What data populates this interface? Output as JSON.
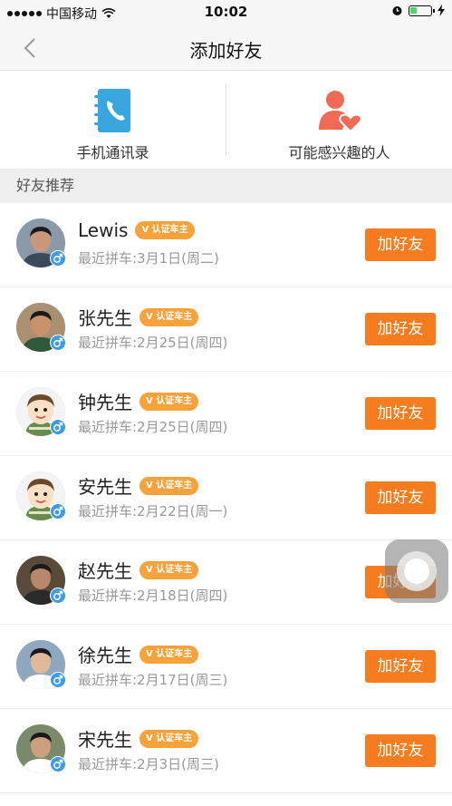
{
  "status_bar": {
    "carrier": "中国移动",
    "time": "10:02",
    "battery_level": 0.35
  },
  "nav": {
    "title": "添加好友",
    "back_icon": "chevron-left-icon"
  },
  "quick_actions": [
    {
      "label": "手机通讯录",
      "icon": "phone-book-icon",
      "color": "#3aa6e0"
    },
    {
      "label": "可能感兴趣的人",
      "icon": "person-heart-icon",
      "color": "#f06a55"
    }
  ],
  "section": {
    "title": "好友推荐"
  },
  "badge_label": "V 认证车主",
  "colors": {
    "accent": "#f57c1f",
    "badge": "#f7a23a",
    "gender": "#3d9be9"
  },
  "friends": [
    {
      "name": "Lewis",
      "sub": "最近拼车:3月1日(周二)",
      "button": "加好友",
      "avatar": "photo"
    },
    {
      "name": "张先生",
      "sub": "最近拼车:2月25日(周四)",
      "button": "加好友",
      "avatar": "photo"
    },
    {
      "name": "钟先生",
      "sub": "最近拼车:2月25日(周四)",
      "button": "加好友",
      "avatar": "cartoon"
    },
    {
      "name": "安先生",
      "sub": "最近拼车:2月22日(周一)",
      "button": "加好友",
      "avatar": "cartoon"
    },
    {
      "name": "赵先生",
      "sub": "最近拼车:2月18日(周四)",
      "button": "加好友",
      "avatar": "photo"
    },
    {
      "name": "徐先生",
      "sub": "最近拼车:2月17日(周三)",
      "button": "加好友",
      "avatar": "photo"
    },
    {
      "name": "宋先生",
      "sub": "最近拼车:2月3日(周三)",
      "button": "加好友",
      "avatar": "photo"
    }
  ]
}
